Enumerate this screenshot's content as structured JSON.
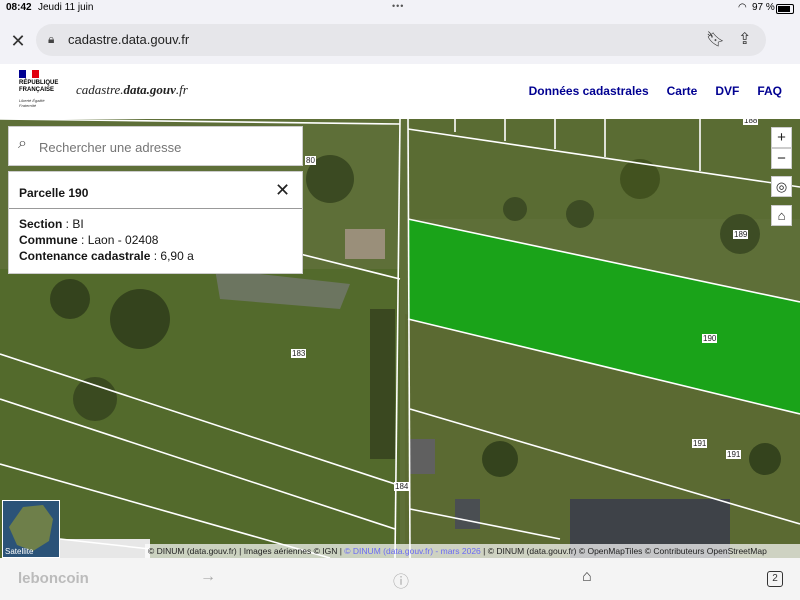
{
  "status_bar": {
    "time": "08:42",
    "date": "Jeudi 11 juin",
    "battery": "97 %"
  },
  "browser": {
    "url": "cadastre.data.gouv.fr"
  },
  "header": {
    "republique_text": "RÉPUBLIQUE FRANÇAISE",
    "motto": "Liberté Égalité Fraternité",
    "site_name_prefix": "cadastre.",
    "site_name_bold": "data.gouv",
    "site_name_suffix": ".fr",
    "nav": [
      {
        "label": "Données cadastrales"
      },
      {
        "label": "Carte"
      },
      {
        "label": "DVF"
      },
      {
        "label": "FAQ"
      }
    ]
  },
  "search": {
    "placeholder": "Rechercher une adresse"
  },
  "parcel_panel": {
    "title": "Parcelle 190",
    "section_label": "Section",
    "section_value": "BI",
    "commune_label": "Commune",
    "commune_value": "Laon - 02408",
    "contenance_label": "Contenance cadastrale",
    "contenance_value": "6,90 a"
  },
  "map": {
    "parcel_labels": [
      "188",
      "189",
      "190",
      "191",
      "191",
      "183",
      "184",
      "80"
    ],
    "selected_parcel_color": "#1aa319",
    "zoom_in": "+",
    "zoom_out": "−",
    "minimap_label": "Satellite",
    "attribution_1": "© DINUM (data.gouv.fr) | Images aériennes © IGN | ",
    "attribution_2": "© DINUM (data.gouv.fr) - mars 2026",
    "attribution_3": " | © DINUM (data.gouv.fr) © OpenMapTiles © Contributeurs OpenStreetMap"
  },
  "bottom_bar": {
    "logo": "leboncoin",
    "tab_count": "2"
  }
}
